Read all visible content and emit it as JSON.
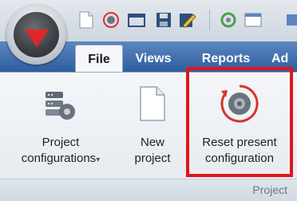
{
  "tabs": [
    {
      "label": "File",
      "active": true
    },
    {
      "label": "Views",
      "active": false
    },
    {
      "label": "Reports",
      "active": false
    },
    {
      "label": "Ad",
      "active": false
    }
  ],
  "ribbon": {
    "project_configurations": {
      "line1": "Project",
      "line2": "configurations",
      "dropdown_caret": "▾"
    },
    "new_project": {
      "line1": "New",
      "line2": "project"
    },
    "reset_configuration": {
      "line1": "Reset present",
      "line2": "configuration"
    },
    "group_label": "Project"
  },
  "colors": {
    "accent_red": "#e3141b",
    "tab_blue": "#2e5e9e",
    "ribbon_bg": "#eef1f5"
  },
  "quick_access_icons": [
    "new-document-icon",
    "reset-gear-icon",
    "open-folder-icon",
    "save-icon",
    "edit-icon",
    "refresh-icon",
    "window-icon"
  ]
}
